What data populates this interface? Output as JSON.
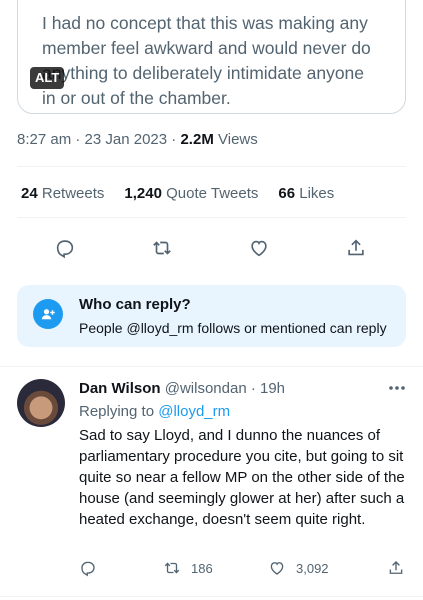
{
  "image_card": {
    "text": "I had no concept that this was making any\nmember feel awkward and would never do\nanything to deliberately intimidate anyone\nin or out of the chamber.",
    "alt_badge": "ALT"
  },
  "meta": {
    "time": "8:27 am",
    "dot1": "·",
    "date": "23 Jan 2023",
    "dot2": "·",
    "views_count": "2.2M",
    "views_label": "Views"
  },
  "stats": {
    "retweets_count": "24",
    "retweets_label": "Retweets",
    "quotes_count": "1,240",
    "quotes_label": "Quote Tweets",
    "likes_count": "66",
    "likes_label": "Likes"
  },
  "who_can_reply": {
    "title": "Who can reply?",
    "subtitle": "People @lloyd_rm follows or mentioned can reply"
  },
  "reply": {
    "author_name": "Dan Wilson",
    "author_handle": "@wilsondan",
    "dot": "·",
    "time": "19h",
    "replying_prefix": "Replying to",
    "replying_to": "@lloyd_rm",
    "body": "Sad to say Lloyd, and I dunno the nuances of parliamentary procedure you cite, but going to sit quite so near a fellow MP on the other side of the house (and seemingly glower at her) after such a heated exchange, doesn't seem quite right.",
    "retweets": "186",
    "likes": "3,092"
  },
  "colors": {
    "accent": "#1d9bf0",
    "secondary_text": "#536471",
    "reply_bg": "#e8f5fe"
  },
  "icons": [
    "reply-icon",
    "retweet-icon",
    "like-icon",
    "share-icon",
    "person-icon",
    "more-icon"
  ]
}
